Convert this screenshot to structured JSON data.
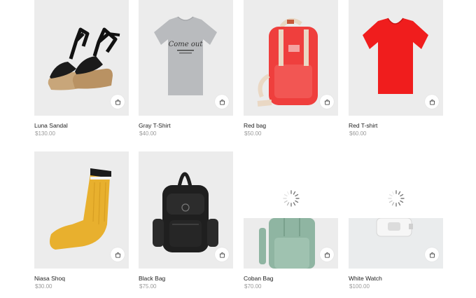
{
  "products": [
    {
      "name": "Luna Sandal",
      "price": "$130.00",
      "icon": "bag-icon"
    },
    {
      "name": "Gray T-Shirt",
      "price": "$40.00",
      "icon": "bag-icon",
      "print": "Come out"
    },
    {
      "name": "Red bag",
      "price": "$50.00",
      "icon": "bag-icon"
    },
    {
      "name": "Red T-shirt",
      "price": "$60.00",
      "icon": "bag-icon"
    },
    {
      "name": "Niasa Shoq",
      "price": "$30.00",
      "icon": "bag-icon"
    },
    {
      "name": "Black Bag",
      "price": "$75.00",
      "icon": "bag-icon"
    },
    {
      "name": "Coban Bag",
      "price": "$70.00",
      "icon": "bag-icon",
      "loading": true
    },
    {
      "name": "White Watch",
      "price": "$100.00",
      "icon": "bag-icon",
      "loading": true
    }
  ],
  "colors": {
    "image_bg": "#ececec",
    "price": "#9a9a9a",
    "red": "#f01d1d"
  }
}
